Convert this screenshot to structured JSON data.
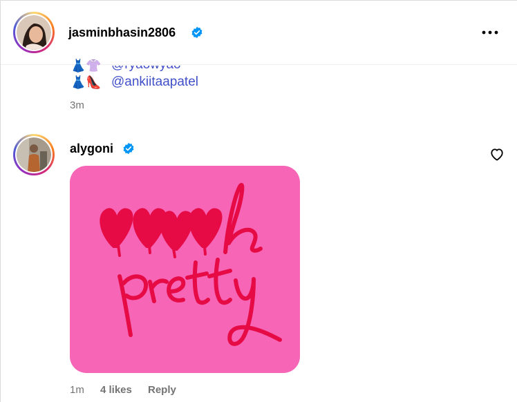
{
  "post": {
    "author": "jasminbhasin2806",
    "more_icon": "more-horizontal-icon",
    "verified_color": "#0095f6"
  },
  "previous_comment": {
    "partial_mention": "@ryaowyao",
    "mention": "@ankiitaapatel",
    "emojis_row1": "👗👚",
    "emojis_row2": "👗👠",
    "time": "3m"
  },
  "comment": {
    "author": "alygoni",
    "sticker": {
      "text_line1": "hhhh",
      "text_line2": "pretty",
      "background": "#f665b6",
      "ink": "#e60a45"
    },
    "time": "1m",
    "likes": "4 likes",
    "reply": "Reply",
    "like_icon": "heart-outline-icon"
  }
}
